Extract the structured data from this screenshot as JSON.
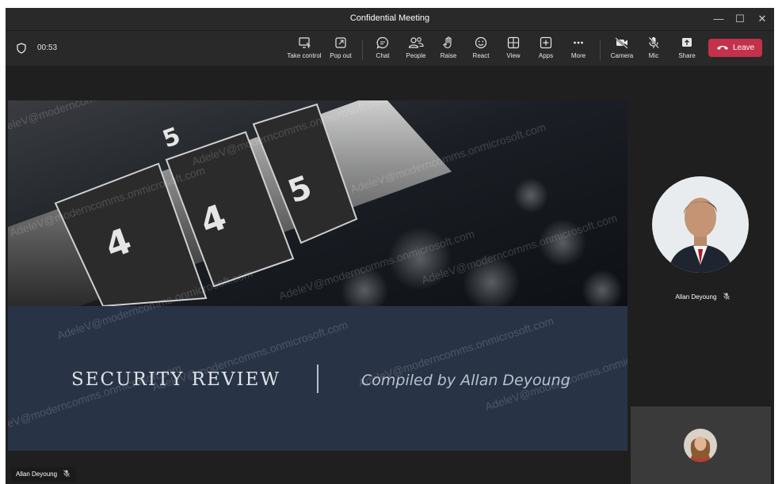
{
  "window": {
    "title": "Confidential Meeting",
    "controls": {
      "minimize": "—",
      "maximize": "☐",
      "close": "✕"
    }
  },
  "toolbar": {
    "timer": "00:53",
    "buttons": [
      {
        "label": "Take control",
        "icon": "take-control-icon"
      },
      {
        "label": "Pop out",
        "icon": "pop-out-icon"
      },
      {
        "label": "Chat",
        "icon": "chat-icon"
      },
      {
        "label": "People",
        "icon": "people-icon"
      },
      {
        "label": "Raise",
        "icon": "raise-hand-icon"
      },
      {
        "label": "React",
        "icon": "react-icon"
      },
      {
        "label": "View",
        "icon": "view-icon"
      },
      {
        "label": "Apps",
        "icon": "apps-icon"
      },
      {
        "label": "More",
        "icon": "more-icon"
      },
      {
        "label": "Camera",
        "icon": "camera-off-icon"
      },
      {
        "label": "Mic",
        "icon": "mic-off-icon"
      },
      {
        "label": "Share",
        "icon": "share-icon"
      }
    ],
    "leave_label": "Leave",
    "leave_color": "#c4314b"
  },
  "slide": {
    "title": "SECURITY REVIEW",
    "subtitle": "Compiled by Allan Deyoung",
    "watermark": "AdeleV@moderncomms.onmicrosoft.com",
    "bottom_color": "#283346"
  },
  "presenter": {
    "name": "Allan Deyoung"
  },
  "participants": [
    {
      "name": "Allan Deyoung",
      "muted": true
    }
  ]
}
